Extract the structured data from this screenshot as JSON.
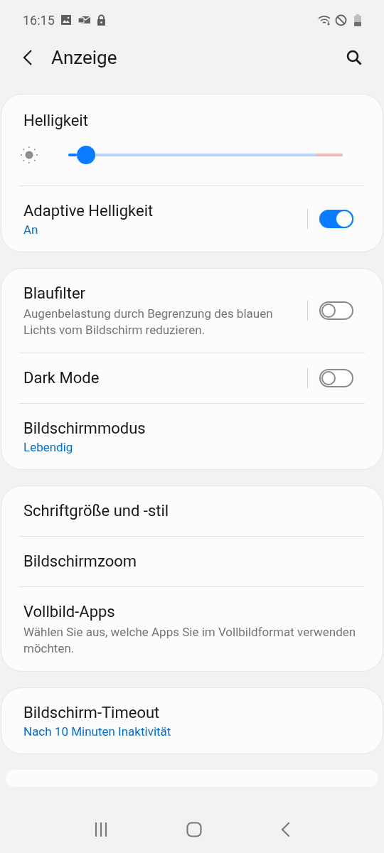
{
  "status_bar": {
    "time": "16:15"
  },
  "app_bar": {
    "title": "Anzeige"
  },
  "cards": [
    {
      "items": [
        {
          "kind": "slider",
          "title": "Helligkeit",
          "level": 0.03
        },
        {
          "kind": "switch",
          "title": "Adaptive Helligkeit",
          "value": "An",
          "on": true
        }
      ]
    },
    {
      "items": [
        {
          "kind": "switch",
          "title": "Blaufilter",
          "description": "Augenbelastung durch Begrenzung des blauen Lichts vom Bildschirm reduzieren.",
          "on": false
        },
        {
          "kind": "switch",
          "title": "Dark Mode",
          "on": false
        },
        {
          "kind": "link",
          "title": "Bildschirmmodus",
          "value": "Lebendig"
        }
      ]
    },
    {
      "items": [
        {
          "kind": "link",
          "title": "Schriftgröße und -stil"
        },
        {
          "kind": "link",
          "title": "Bildschirmzoom"
        },
        {
          "kind": "link",
          "title": "Vollbild-Apps",
          "description": "Wählen Sie aus, welche Apps Sie im Vollbildformat verwenden möchten."
        }
      ]
    },
    {
      "items": [
        {
          "kind": "link",
          "title": "Bildschirm-Timeout",
          "value": "Nach 10 Minuten Inaktivität"
        }
      ]
    }
  ]
}
